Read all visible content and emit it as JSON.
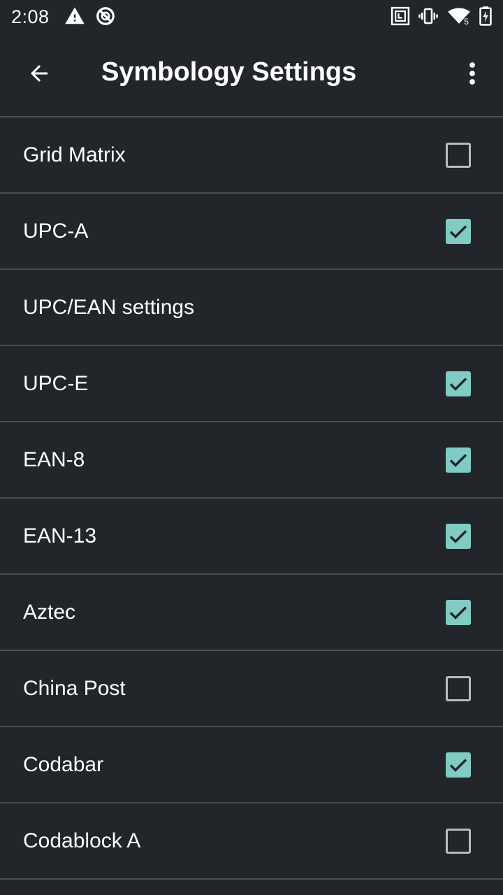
{
  "status_bar": {
    "time": "2:08",
    "icons": [
      "warning-icon",
      "do-not-disturb-icon",
      "nfc-icon",
      "vibrate-icon",
      "wifi-icon",
      "battery-charging-icon"
    ],
    "wifi_badge": "5"
  },
  "app_bar": {
    "title": "Symbology Settings",
    "back_icon": "arrow-back-icon",
    "menu_icon": "more-vert-icon"
  },
  "colors": {
    "background": "#22262a",
    "divider": "#4a4e52",
    "checkbox_checked": "#80cbc4",
    "checkbox_unchecked_border": "#b8bcc0"
  },
  "settings": [
    {
      "label": "Grid Matrix",
      "has_checkbox": true,
      "checked": false
    },
    {
      "label": "UPC-A",
      "has_checkbox": true,
      "checked": true
    },
    {
      "label": "UPC/EAN settings",
      "has_checkbox": false,
      "checked": false
    },
    {
      "label": "UPC-E",
      "has_checkbox": true,
      "checked": true
    },
    {
      "label": "EAN-8",
      "has_checkbox": true,
      "checked": true
    },
    {
      "label": "EAN-13",
      "has_checkbox": true,
      "checked": true
    },
    {
      "label": "Aztec",
      "has_checkbox": true,
      "checked": true
    },
    {
      "label": "China Post",
      "has_checkbox": true,
      "checked": false
    },
    {
      "label": "Codabar",
      "has_checkbox": true,
      "checked": true
    },
    {
      "label": "Codablock A",
      "has_checkbox": true,
      "checked": false
    }
  ]
}
